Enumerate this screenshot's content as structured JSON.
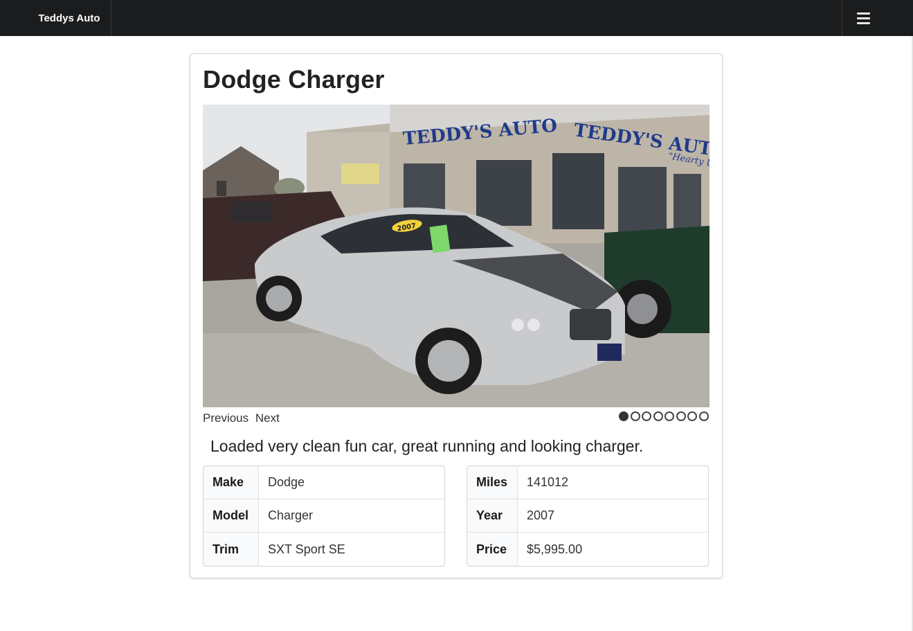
{
  "navbar": {
    "brand": "Teddys Auto",
    "menu_icon": "hamburger-menu-icon"
  },
  "listing": {
    "title": "Dodge Charger",
    "carousel": {
      "previous_label": "Previous",
      "next_label": "Next",
      "slide_count": 8,
      "active_index": 0,
      "photo_signs": {
        "dealership_sign": "TEDDY'S AUTO",
        "tagline": "\"Hearty Used\"",
        "windshield_sticker": "2007"
      }
    },
    "description": "Loaded very clean fun car, great running and looking charger.",
    "specs_left": [
      {
        "key": "Make",
        "value": "Dodge"
      },
      {
        "key": "Model",
        "value": "Charger"
      },
      {
        "key": "Trim",
        "value": "SXT Sport SE"
      }
    ],
    "specs_right": [
      {
        "key": "Miles",
        "value": "141012"
      },
      {
        "key": "Year",
        "value": "2007"
      },
      {
        "key": "Price",
        "value": "$5,995.00"
      }
    ]
  },
  "colors": {
    "navbar_bg": "#1b1c1d",
    "car": "#c9cacc",
    "sign_text": "#1f3a8a"
  }
}
